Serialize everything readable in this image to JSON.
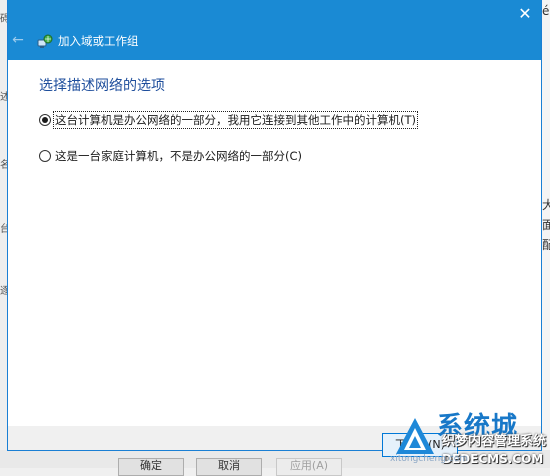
{
  "background_window": {
    "left_fragments": [
      "碍",
      "述",
      "名",
      "台",
      "逐"
    ],
    "right_fragments": [
      "é",
      "大",
      "面",
      "配"
    ],
    "buttons": [
      {
        "label": "确定",
        "disabled": false
      },
      {
        "label": "取消",
        "disabled": false
      },
      {
        "label": "应用(A)",
        "disabled": true
      }
    ]
  },
  "dialog": {
    "title": "加入域或工作组",
    "close_glyph": "✕",
    "back_glyph": "←",
    "heading": "选择描述网络的选项",
    "options": [
      {
        "label": "这台计算机是办公网络的一部分，我用它连接到其他工作中的计算机(T)",
        "selected": true
      },
      {
        "label": "这是一台家庭计算机，不是办公网络的一部分(C)",
        "selected": false
      }
    ],
    "next_label": "下一步(N)"
  },
  "watermark": {
    "brand": "系统城",
    "brand_url": "xitongcheng.com",
    "site_name": "织梦内容管理系统",
    "site_domain": "DEDECMS.COM"
  },
  "colors": {
    "titlebar": "#1a8ad4",
    "heading": "#1e4e9c",
    "brand": "#1878c8"
  }
}
